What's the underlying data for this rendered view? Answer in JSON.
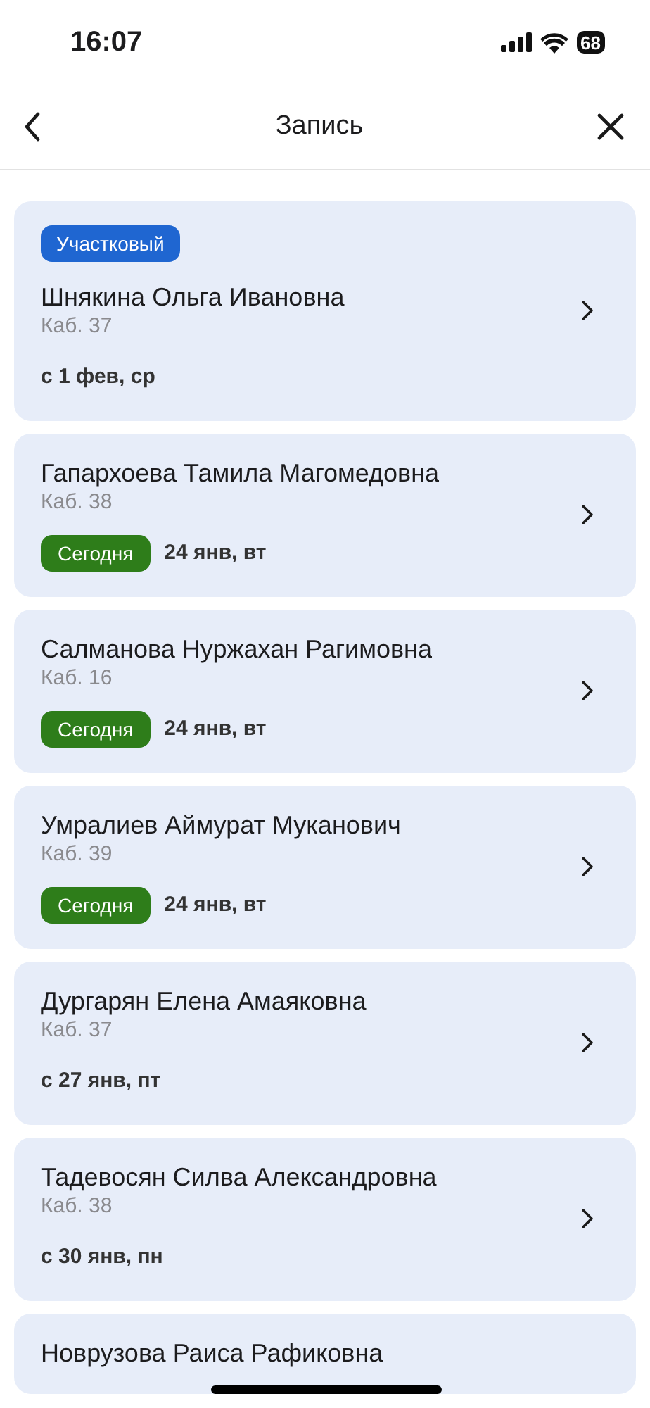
{
  "status_bar": {
    "time": "16:07",
    "battery": "68"
  },
  "header": {
    "title": "Запись"
  },
  "cards": [
    {
      "tag": "Участковый",
      "name": "Шнякина Ольга Ивановна",
      "room": "Каб. 37",
      "date": "с 1 фев, ср"
    },
    {
      "name": "Гапархоева Тамила Магомедовна",
      "room": "Каб. 38",
      "badge": "Сегодня",
      "date": "24 янв, вт"
    },
    {
      "name": "Салманова Нуржахан Рагимовна",
      "room": "Каб. 16",
      "badge": "Сегодня",
      "date": "24 янв, вт"
    },
    {
      "name": "Умралиев Аймурат Муканович",
      "room": "Каб. 39",
      "badge": "Сегодня",
      "date": "24 янв, вт"
    },
    {
      "name": "Дургарян Елена Амаяковна",
      "room": "Каб. 37",
      "date": "с 27 янв, пт"
    },
    {
      "name": "Тадевосян Силва Александровна",
      "room": "Каб. 38",
      "date": "с 30 янв, пн"
    },
    {
      "name": "Новрузова Раиса Рафиковна"
    }
  ]
}
